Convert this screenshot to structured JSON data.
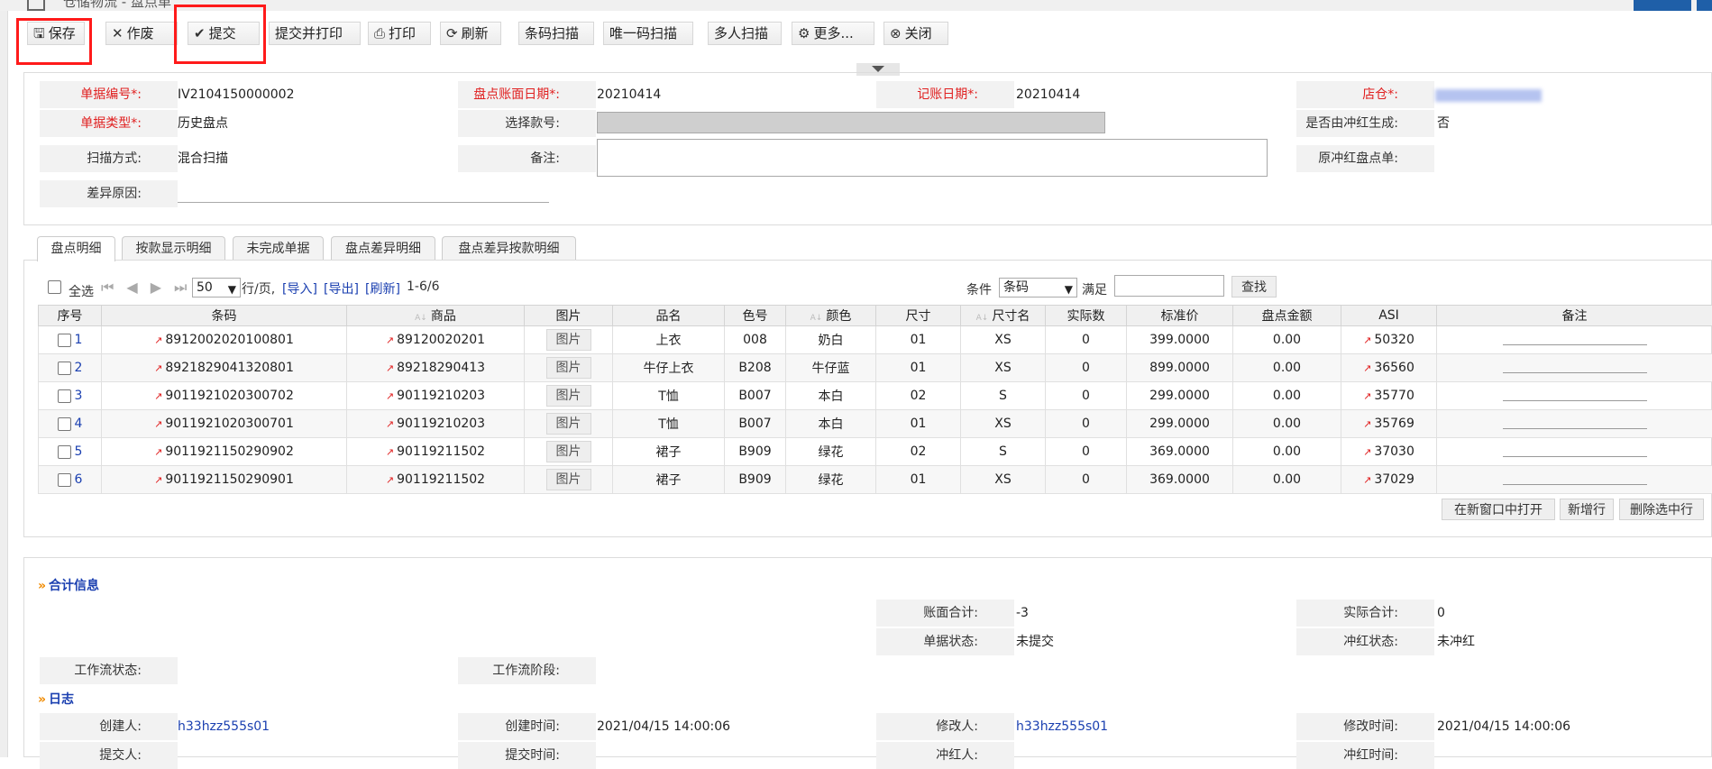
{
  "window": {
    "title": "仓储物流 - 盘点单",
    "accent": "#1f5fa8"
  },
  "toolbar": {
    "buttons": [
      {
        "label": "保存",
        "icon": "save-icon"
      },
      {
        "label": "作废",
        "icon": "cross-icon"
      },
      {
        "label": "提交",
        "icon": "check-icon"
      },
      {
        "label": "提交并打印",
        "icon": "none"
      },
      {
        "label": "打印",
        "icon": "printer-icon"
      },
      {
        "label": "刷新",
        "icon": "refresh-icon"
      },
      {
        "label": "条码扫描",
        "icon": "none"
      },
      {
        "label": "唯一码扫描",
        "icon": "none"
      },
      {
        "label": "多人扫描",
        "icon": "none"
      },
      {
        "label": "更多...",
        "icon": "more-icon"
      },
      {
        "label": "关闭",
        "icon": "close-icon"
      }
    ],
    "highlight_color": "#ff1a1a"
  },
  "header_form": {
    "doc_no_label": "单据编号*:",
    "doc_no": "IV2104150000002",
    "doc_type_label": "单据类型*:",
    "doc_type": "历史盘点",
    "scan_mode_label": "扫描方式:",
    "scan_mode": "混合扫描",
    "diff_reason_label": "差异原因:",
    "book_date_label": "盘点账面日期*:",
    "book_date": "20210414",
    "select_style_label": "选择款号:",
    "remark_label": "备注:",
    "post_date_label": "记账日期*:",
    "post_date": "20210414",
    "store_label": "店仓*:",
    "reversal_label": "是否由冲红生成:",
    "reversal": "否",
    "orig_reversal_label": "原冲红盘点单:"
  },
  "tabs": [
    "盘点明细",
    "按款显示明细",
    "未完成单据",
    "盘点差异明细",
    "盘点差异按款明细"
  ],
  "grid_controls": {
    "select_all": "全选",
    "page_size": "50",
    "per_page": "行/页,",
    "import": "[导入]",
    "export": "[导出]",
    "refresh": "[刷新]",
    "range": "1-6/6",
    "condition_label": "条件",
    "condition_value": "条码",
    "satisfy_label": "满足",
    "search_button": "查找"
  },
  "table": {
    "columns": [
      "序号",
      "条码",
      "商品",
      "图片",
      "品名",
      "色号",
      "颜色",
      "尺寸",
      "尺寸名",
      "实际数",
      "标准价",
      "盘点金额",
      "ASI",
      "备注"
    ],
    "image_button": "图片",
    "rows": [
      {
        "no": "1",
        "barcode": "8912002020100801",
        "product": "89120020201",
        "name": "上衣",
        "color_code": "008",
        "color": "奶白",
        "size": "01",
        "size_name": "XS",
        "actual": "0",
        "price": "399.0000",
        "amount": "0.00",
        "asi": "50320"
      },
      {
        "no": "2",
        "barcode": "8921829041320801",
        "product": "89218290413",
        "name": "牛仔上衣",
        "color_code": "B208",
        "color": "牛仔蓝",
        "size": "01",
        "size_name": "XS",
        "actual": "0",
        "price": "899.0000",
        "amount": "0.00",
        "asi": "36560"
      },
      {
        "no": "3",
        "barcode": "9011921020300702",
        "product": "90119210203",
        "name": "T恤",
        "color_code": "B007",
        "color": "本白",
        "size": "02",
        "size_name": "S",
        "actual": "0",
        "price": "299.0000",
        "amount": "0.00",
        "asi": "35770"
      },
      {
        "no": "4",
        "barcode": "9011921020300701",
        "product": "90119210203",
        "name": "T恤",
        "color_code": "B007",
        "color": "本白",
        "size": "01",
        "size_name": "XS",
        "actual": "0",
        "price": "299.0000",
        "amount": "0.00",
        "asi": "35769"
      },
      {
        "no": "5",
        "barcode": "9011921150290902",
        "product": "90119211502",
        "name": "裙子",
        "color_code": "B909",
        "color": "绿花",
        "size": "02",
        "size_name": "S",
        "actual": "0",
        "price": "369.0000",
        "amount": "0.00",
        "asi": "37030"
      },
      {
        "no": "6",
        "barcode": "9011921150290901",
        "product": "90119211502",
        "name": "裙子",
        "color_code": "B909",
        "color": "绿花",
        "size": "01",
        "size_name": "XS",
        "actual": "0",
        "price": "369.0000",
        "amount": "0.00",
        "asi": "37029"
      }
    ]
  },
  "grid_actions": [
    "在新窗口中打开",
    "新增行",
    "删除选中行"
  ],
  "summary": {
    "title": "合计信息",
    "book_total_label": "账面合计:",
    "book_total": "-3",
    "actual_total_label": "实际合计:",
    "actual_total": "0",
    "doc_status_label": "单据状态:",
    "doc_status": "未提交",
    "reversal_status_label": "冲红状态:",
    "reversal_status": "未冲红",
    "workflow_status_label": "工作流状态:",
    "workflow_stage_label": "工作流阶段:"
  },
  "log": {
    "title": "日志",
    "creator_label": "创建人:",
    "creator": "h33hzz555s01",
    "created_label": "创建时间:",
    "created": "2021/04/15 14:00:06",
    "modifier_label": "修改人:",
    "modifier": "h33hzz555s01",
    "modified_label": "修改时间:",
    "modified": "2021/04/15 14:00:06",
    "submitter_label": "提交人:",
    "submitted_label": "提交时间:",
    "reverser_label": "冲红人:",
    "reversed_label": "冲红时间:"
  }
}
